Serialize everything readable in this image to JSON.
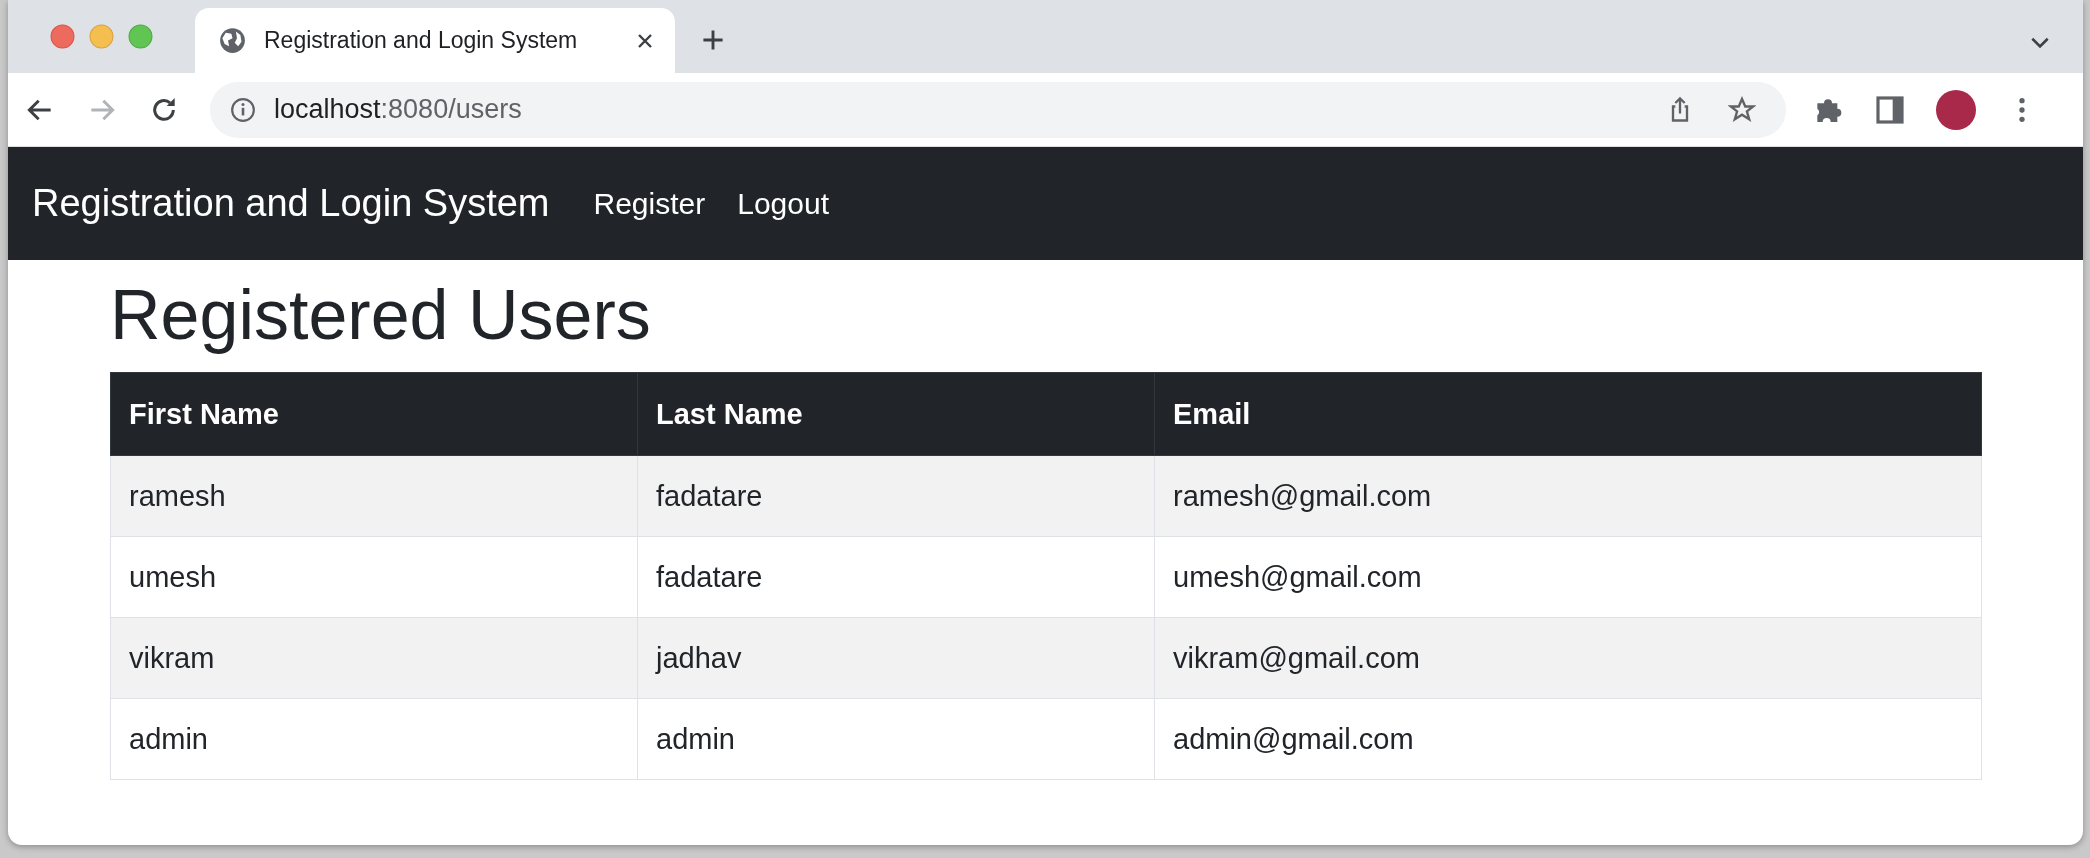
{
  "browser": {
    "tab_title": "Registration and Login System",
    "url_host": "localhost",
    "url_rest": ":8080/users"
  },
  "navbar": {
    "brand": "Registration and Login System",
    "links": [
      "Register",
      "Logout"
    ]
  },
  "heading": "Registered Users",
  "table": {
    "columns": [
      "First Name",
      "Last Name",
      "Email"
    ],
    "rows": [
      [
        "ramesh",
        "fadatare",
        "ramesh@gmail.com"
      ],
      [
        "umesh",
        "fadatare",
        "umesh@gmail.com"
      ],
      [
        "vikram",
        "jadhav",
        "vikram@gmail.com"
      ],
      [
        "admin",
        "admin",
        "admin@gmail.com"
      ]
    ]
  }
}
